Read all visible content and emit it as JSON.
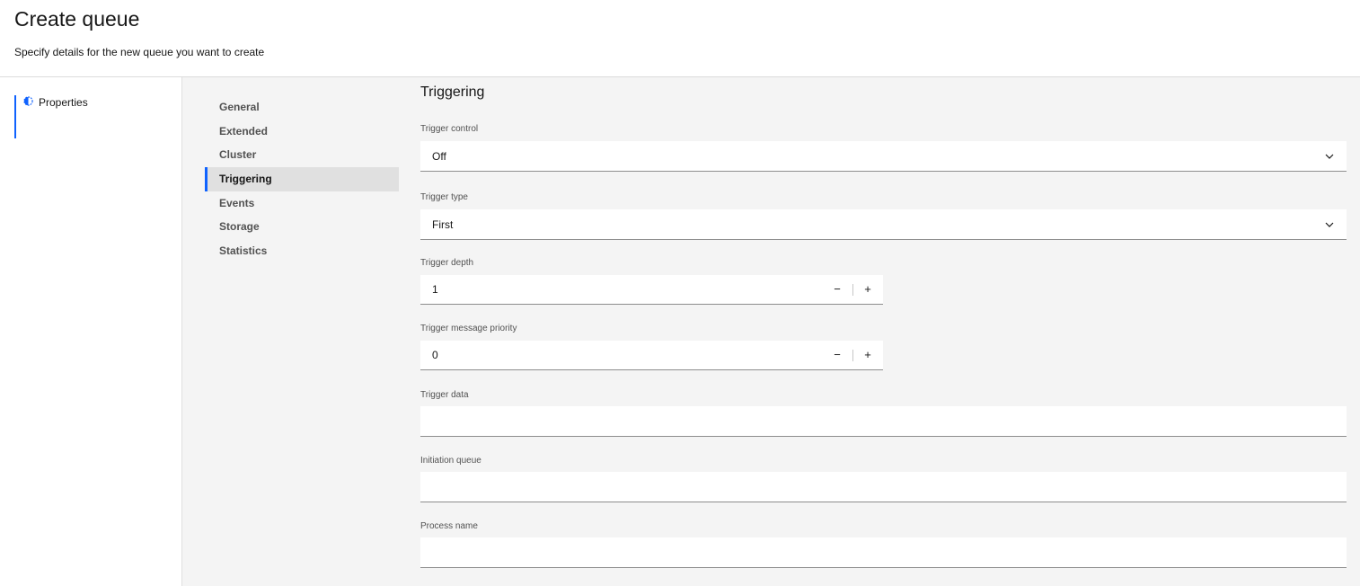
{
  "header": {
    "title": "Create queue",
    "subtitle": "Specify details for the new queue you want to create"
  },
  "left_nav": {
    "steps": [
      {
        "label": "Properties",
        "icon": "half-circle-progress-icon",
        "state": "current"
      }
    ]
  },
  "subnav": {
    "items": [
      {
        "label": "General",
        "active": false
      },
      {
        "label": "Extended",
        "active": false
      },
      {
        "label": "Cluster",
        "active": false
      },
      {
        "label": "Triggering",
        "active": true
      },
      {
        "label": "Events",
        "active": false
      },
      {
        "label": "Storage",
        "active": false
      },
      {
        "label": "Statistics",
        "active": false
      }
    ]
  },
  "form": {
    "section_title": "Triggering",
    "trigger_control": {
      "label": "Trigger control",
      "value": "Off"
    },
    "trigger_type": {
      "label": "Trigger type",
      "value": "First"
    },
    "trigger_depth": {
      "label": "Trigger depth",
      "value": "1",
      "decrement": "−",
      "increment": "+"
    },
    "trigger_message_priority": {
      "label": "Trigger message priority",
      "value": "0",
      "decrement": "−",
      "increment": "+"
    },
    "trigger_data": {
      "label": "Trigger data",
      "value": ""
    },
    "initiation_queue": {
      "label": "Initiation queue",
      "value": ""
    },
    "process_name": {
      "label": "Process name",
      "value": ""
    }
  },
  "colors": {
    "accent": "#0f62fe",
    "background": "#f4f4f4",
    "field_bg": "#ffffff",
    "text_primary": "#161616",
    "text_secondary": "#525252"
  }
}
